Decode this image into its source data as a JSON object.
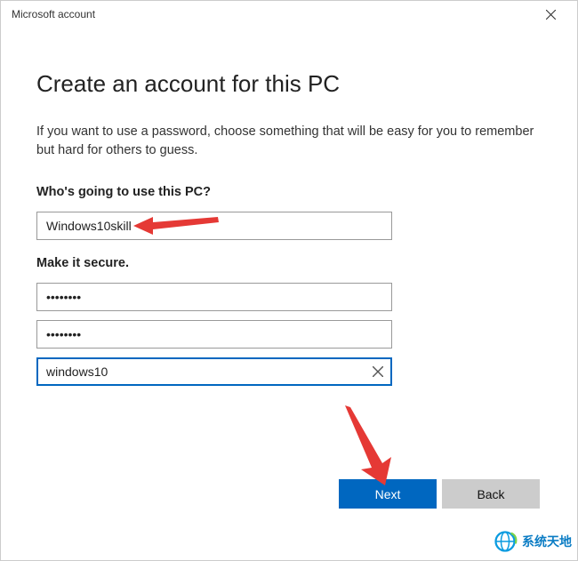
{
  "titlebar": {
    "title": "Microsoft account"
  },
  "heading": "Create an account for this PC",
  "description": "If you want to use a password, choose something that will be easy for you to remember but hard for others to guess.",
  "sections": {
    "username_label": "Who's going to use this PC?",
    "password_label": "Make it secure."
  },
  "fields": {
    "username": {
      "value": "Windows10skill"
    },
    "password": {
      "value": "••••••••"
    },
    "password_confirm": {
      "value": "••••••••"
    },
    "hint": {
      "value": "windows10"
    }
  },
  "buttons": {
    "next": "Next",
    "back": "Back"
  },
  "watermark": {
    "text": "系统天地"
  }
}
